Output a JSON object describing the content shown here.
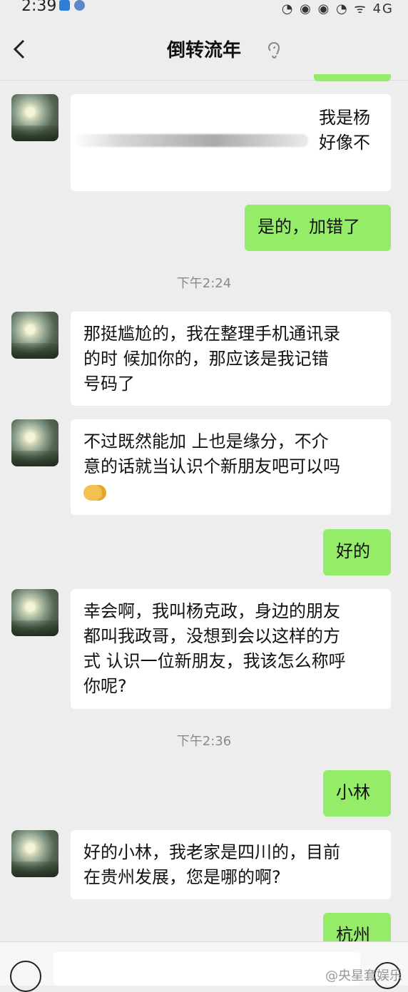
{
  "status_bar": {
    "time": "2:39",
    "right_icons": "◔ ◉ ◉ ◔ ᯤ 4G"
  },
  "header": {
    "title": "倒转流年"
  },
  "messages": [
    {
      "side": "left",
      "lines": [
        "我是杨",
        "好像不"
      ]
    },
    {
      "side": "right",
      "lines": [
        "是的，加错了"
      ]
    },
    {
      "type": "time",
      "text": "下午2:24"
    },
    {
      "side": "left",
      "lines": [
        "那挺尴尬的，我在整理手机通讯录",
        "的时  候加你的，那应该是我记错",
        "号码了"
      ]
    },
    {
      "side": "left",
      "lines": [
        "不过既然能加  上也是缘分，不介",
        "意的话就当认识个新朋友吧可以吗"
      ],
      "emoji": "handshake"
    },
    {
      "side": "right",
      "lines": [
        "好的"
      ]
    },
    {
      "side": "left",
      "lines": [
        "幸会啊，我叫杨克政，身边的朋友",
        "都叫我政哥，没想到会以这样的方",
        "式 认识一位新朋友，我该怎么称呼",
        "你呢?"
      ]
    },
    {
      "type": "time",
      "text": "下午2:36"
    },
    {
      "side": "right",
      "lines": [
        "小林"
      ]
    },
    {
      "side": "left",
      "lines": [
        "好的小林，我老家是四川的，目前",
        "在贵州发展，您是哪的啊?"
      ]
    },
    {
      "side": "right",
      "lines": [
        "杭州"
      ]
    }
  ],
  "input": {
    "placeholder": ""
  },
  "watermark": "@央星套娱乐",
  "colors": {
    "background": "#ededed",
    "incoming_bubble": "#ffffff",
    "outgoing_bubble": "#95ec69"
  }
}
